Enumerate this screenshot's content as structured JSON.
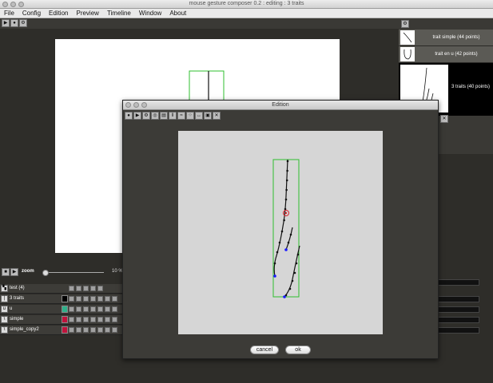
{
  "window": {
    "title": "mouse gesture composer 0.2 : editing : 3 traits"
  },
  "menu": [
    "File",
    "Config",
    "Edition",
    "Preview",
    "Timeline",
    "Window",
    "About"
  ],
  "traits": [
    {
      "label": "trait simple (44 points)"
    },
    {
      "label": "trait en u (42 points)"
    },
    {
      "label": "3 traits (40 points)"
    }
  ],
  "zoom": {
    "label": "zoom",
    "value": "10 %",
    "level": 0.03
  },
  "layers": [
    {
      "name": "test (4)",
      "color": "#000000"
    },
    {
      "name": "3 traits",
      "color": "#000000"
    },
    {
      "name": "u",
      "color": "#2fb08a"
    },
    {
      "name": "simple",
      "color": "#c0143c"
    },
    {
      "name": "simple_copy2",
      "color": "#c0143c"
    }
  ],
  "dialog": {
    "title": "Edition",
    "cancel_label": "cancel",
    "ok_label": "ok"
  },
  "colors": {
    "stroke": "#111111",
    "bbox": "#2fbf2f",
    "anchor": "#d8252e",
    "endpoint": "#1a1aff"
  },
  "icons": [
    "play-icon",
    "record-icon",
    "settings-icon",
    "close-icon"
  ]
}
